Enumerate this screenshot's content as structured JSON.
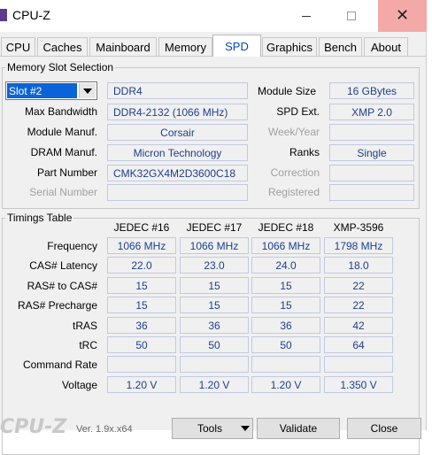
{
  "window": {
    "title": "CPU-Z",
    "minimize_glyph": "—",
    "maximize_glyph": "☐",
    "close_glyph": "✕"
  },
  "tabs": [
    {
      "label": "CPU"
    },
    {
      "label": "Caches"
    },
    {
      "label": "Mainboard"
    },
    {
      "label": "Memory"
    },
    {
      "label": "SPD"
    },
    {
      "label": "Graphics"
    },
    {
      "label": "Bench"
    },
    {
      "label": "About"
    }
  ],
  "slot_selection": {
    "group_title": "Memory Slot Selection",
    "slot_value": "Slot #2",
    "memory_type": "DDR4",
    "module_size_label": "Module Size",
    "module_size": "16 GBytes",
    "max_bandwidth_label": "Max Bandwidth",
    "max_bandwidth": "DDR4-2132 (1066 MHz)",
    "spd_ext_label": "SPD Ext.",
    "spd_ext": "XMP 2.0",
    "module_manuf_label": "Module Manuf.",
    "module_manuf": "Corsair",
    "week_year_label": "Week/Year",
    "week_year": "",
    "dram_manuf_label": "DRAM Manuf.",
    "dram_manuf": "Micron Technology",
    "ranks_label": "Ranks",
    "ranks": "Single",
    "part_number_label": "Part Number",
    "part_number": "CMK32GX4M2D3600C18",
    "correction_label": "Correction",
    "correction": "",
    "serial_number_label": "Serial Number",
    "serial_number": "",
    "registered_label": "Registered",
    "registered": ""
  },
  "timings": {
    "group_title": "Timings Table",
    "columns": [
      "JEDEC #16",
      "JEDEC #17",
      "JEDEC #18",
      "XMP-3596"
    ],
    "rows": [
      {
        "label": "Frequency",
        "values": [
          "1066 MHz",
          "1066 MHz",
          "1066 MHz",
          "1798 MHz"
        ]
      },
      {
        "label": "CAS# Latency",
        "values": [
          "22.0",
          "23.0",
          "24.0",
          "18.0"
        ]
      },
      {
        "label": "RAS# to CAS#",
        "values": [
          "15",
          "15",
          "15",
          "22"
        ]
      },
      {
        "label": "RAS# Precharge",
        "values": [
          "15",
          "15",
          "15",
          "22"
        ]
      },
      {
        "label": "tRAS",
        "values": [
          "36",
          "36",
          "36",
          "42"
        ]
      },
      {
        "label": "tRC",
        "values": [
          "50",
          "50",
          "50",
          "64"
        ]
      },
      {
        "label": "Command Rate",
        "values": [
          "",
          "",
          "",
          ""
        ]
      },
      {
        "label": "Voltage",
        "values": [
          "1.20 V",
          "1.20 V",
          "1.20 V",
          "1.350 V"
        ]
      }
    ]
  },
  "footer": {
    "logo": "CPU-Z",
    "version": "Ver. 1.9x.x64",
    "tools_label": "Tools",
    "validate_label": "Validate",
    "close_label": "Close"
  }
}
